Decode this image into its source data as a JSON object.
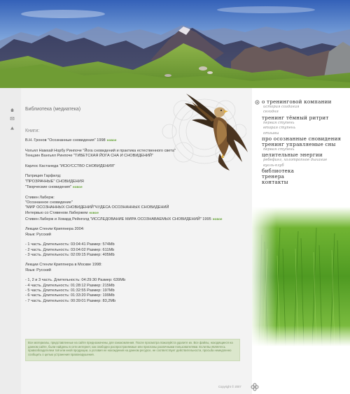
{
  "content": {
    "section_title": "Библиотека (медиатека)",
    "books_label": "Книги:",
    "new_badge": "новое",
    "lines": [
      {
        "text": "В.Н. Гронов \"Осознанные сновидения\" 1998",
        "new": true
      },
      {
        "text": "",
        "new": false
      },
      {
        "text": "Чогьял Намхай Норбу Ринпоче \"Йога сновидений и практика естественного света\"",
        "new": false
      },
      {
        "text": "Тенцзин Вангьял Ринпоче \"ТИБЕТСКАЯ ЙОГА СНА И СНОВИДЕНИЙ\"",
        "new": false
      },
      {
        "text": "",
        "new": false
      },
      {
        "text": "Карлос Кастанеда \"ИСКУССТВО СНОВИДЕНИЯ\"",
        "new": false
      },
      {
        "text": "",
        "new": false
      },
      {
        "text": "Патриция Гарфилд:",
        "new": false
      },
      {
        "text": "\"ПРОЗРАЧНЫЕ\" СНОВИДЕНИЯ",
        "new": false
      },
      {
        "text": "\"Творческие сновидения\"",
        "new": true
      },
      {
        "text": "",
        "new": false
      },
      {
        "text": "Стивен Лаберж:",
        "new": false
      },
      {
        "text": "\"Осознанное сновидение\"",
        "new": false
      },
      {
        "text": "\"МИР ОСОЗНАННЫХ СНОВИДЕНИЙ\"ЧУДЕСА ОСОЗНАННЫХ СНОВИДЕНИЙ",
        "new": false
      },
      {
        "text": "Интервью со Стивеном Лабержем",
        "new": true
      },
      {
        "text": "Стивен Лаберж и Ховард Рейнголд \"ИССЛЕДОВАНИЕ МИРА ОСОЗНАВАЕМЫХ СНОВИДЕНИЙ\" 1995",
        "new": true
      },
      {
        "text": "",
        "new": false
      },
      {
        "text": "Лекции Стенли Криппнера 2004:",
        "new": false
      },
      {
        "text": "Язык: Русский",
        "new": false
      },
      {
        "text": "",
        "new": false
      },
      {
        "text": "- 1 часть. Длительность: 03:04:41 Размер: 574Mb",
        "new": false
      },
      {
        "text": "- 2 часть. Длительность: 03:04:02 Размер: 611Mb",
        "new": false
      },
      {
        "text": "- 3 часть. Длительность: 02:09:15 Размер: 405Mb",
        "new": false
      },
      {
        "text": "",
        "new": false
      },
      {
        "text": "Лекции Стенли Криппнера в Москве 1998:",
        "new": false
      },
      {
        "text": "Язык: Русский",
        "new": false
      },
      {
        "text": "",
        "new": false
      },
      {
        "text": "- 1, 2 и 3 часть. Длительность: 04:29:30 Размер: 639Mb",
        "new": false
      },
      {
        "text": "- 4 часть. Длительность: 01:28:12 Размер: 215Mb",
        "new": false
      },
      {
        "text": "- 5 часть. Длительность: 01:32:55 Размер: 197Mb",
        "new": false
      },
      {
        "text": "- 6 часть. Длительность: 01:33:20 Размер: 199Mb",
        "new": false
      },
      {
        "text": "- 7 часть. Длительность: 00:39:01 Размер: 83,2Mb",
        "new": false
      }
    ],
    "notice": "Все материалы, представленные на сайте предназначены для ознакомления. После просмотра пожалуйста удалите их. Все файлы, находящиеся на данном сайте, были найдены в сети интернет, как свободно распространяемые или присланы различными пользователями. Если Вы являетесь правообладателем той или иной продукции, а условия ее нахождения на данном ресурсе, не соответствует действительности, просьба немедленно сообщить о целью устранения правонарушения.",
    "copyright": "Copyright © 2007"
  },
  "menu": {
    "items": [
      {
        "label": "о тренинговой компании",
        "type": "main"
      },
      {
        "label": "история создания",
        "type": "sub"
      },
      {
        "label": "сегодня",
        "type": "sub"
      },
      {
        "label": "тренинг тёмный ритрит",
        "type": "main"
      },
      {
        "label": "первая ступень",
        "type": "sub"
      },
      {
        "label": "вторая ступень",
        "type": "sub"
      },
      {
        "label": "отзывы",
        "type": "sub"
      },
      {
        "label": "про осознанные сновидения",
        "type": "main"
      },
      {
        "label": "тренинг управляемые сны",
        "type": "main"
      },
      {
        "label": "первая ступень",
        "type": "sub"
      },
      {
        "label": "целительные энергии",
        "type": "main"
      },
      {
        "label": "ребефинг, холотропное дыхание",
        "type": "sub"
      },
      {
        "label": "вуаль-клуб",
        "type": "sub"
      },
      {
        "label": "библиотека",
        "type": "main"
      },
      {
        "label": "тренера",
        "type": "main"
      },
      {
        "label": "контакты",
        "type": "main"
      }
    ]
  },
  "icons": {
    "gutter": [
      "home-icon",
      "mail-icon",
      "sitemap-icon"
    ],
    "menu_bullet": "flower-icon"
  },
  "colors": {
    "new_badge": "#63a233",
    "notice_bg": "#dbe7cc",
    "sky": "#3f6ec4"
  }
}
